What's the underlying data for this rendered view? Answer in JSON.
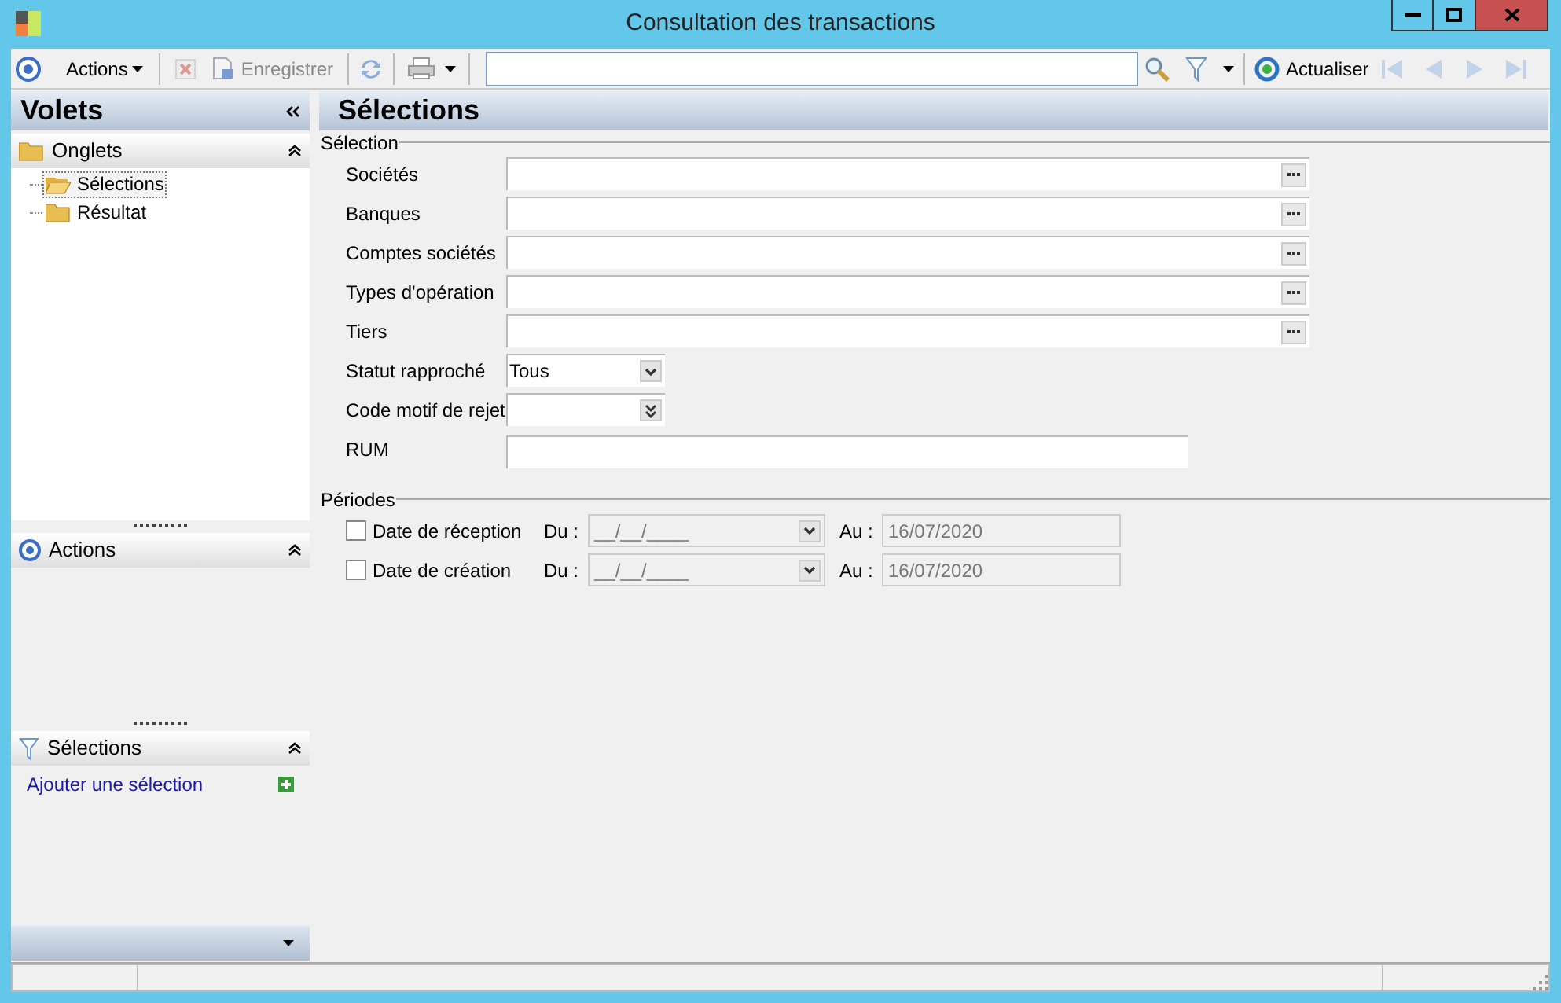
{
  "window": {
    "title": "Consultation des transactions"
  },
  "toolbar": {
    "actions_label": "Actions",
    "delete": {
      "disabled": true
    },
    "save": {
      "label": "Enregistrer",
      "disabled": true
    },
    "refresh_label": "Actualiser",
    "nav": [
      {
        "kind": "first",
        "disabled": true
      },
      {
        "kind": "prev",
        "disabled": true
      },
      {
        "kind": "next",
        "disabled": true
      },
      {
        "kind": "last",
        "disabled": true
      }
    ]
  },
  "sidebar": {
    "title": "Volets",
    "tabs_section": {
      "title": "Onglets",
      "expanded": true,
      "items": [
        {
          "label": "Sélections",
          "selected": true
        },
        {
          "label": "Résultat",
          "selected": false
        }
      ]
    },
    "actions_section": {
      "title": "Actions",
      "expanded": true
    },
    "selections_section": {
      "title": "Sélections",
      "expanded": true,
      "link": "Ajouter une sélection"
    }
  },
  "main": {
    "title": "Sélections",
    "selection_group": {
      "title": "Sélection",
      "fields": [
        {
          "label": "Sociétés",
          "kind": "lookup"
        },
        {
          "label": "Banques",
          "kind": "lookup"
        },
        {
          "label": "Comptes sociétés",
          "kind": "lookup"
        },
        {
          "label": "Types d'opération",
          "kind": "lookup"
        },
        {
          "label": "Tiers",
          "kind": "lookup"
        },
        {
          "label": "Statut rapproché",
          "kind": "combo",
          "value": "Tous"
        },
        {
          "label": "Code motif de rejet",
          "kind": "multicombo"
        },
        {
          "label": "RUM",
          "kind": "text"
        }
      ]
    },
    "periods_group": {
      "title": "Périodes",
      "rows": [
        {
          "label": "Date de réception",
          "checked": false,
          "from_label": "Du :",
          "from_placeholder": "__/__/____",
          "to_label": "Au :",
          "to_value": "16/07/2020"
        },
        {
          "label": "Date de création",
          "checked": false,
          "from_label": "Du :",
          "from_placeholder": "__/__/____",
          "to_label": "Au :",
          "to_value": "16/07/2020"
        }
      ]
    }
  }
}
